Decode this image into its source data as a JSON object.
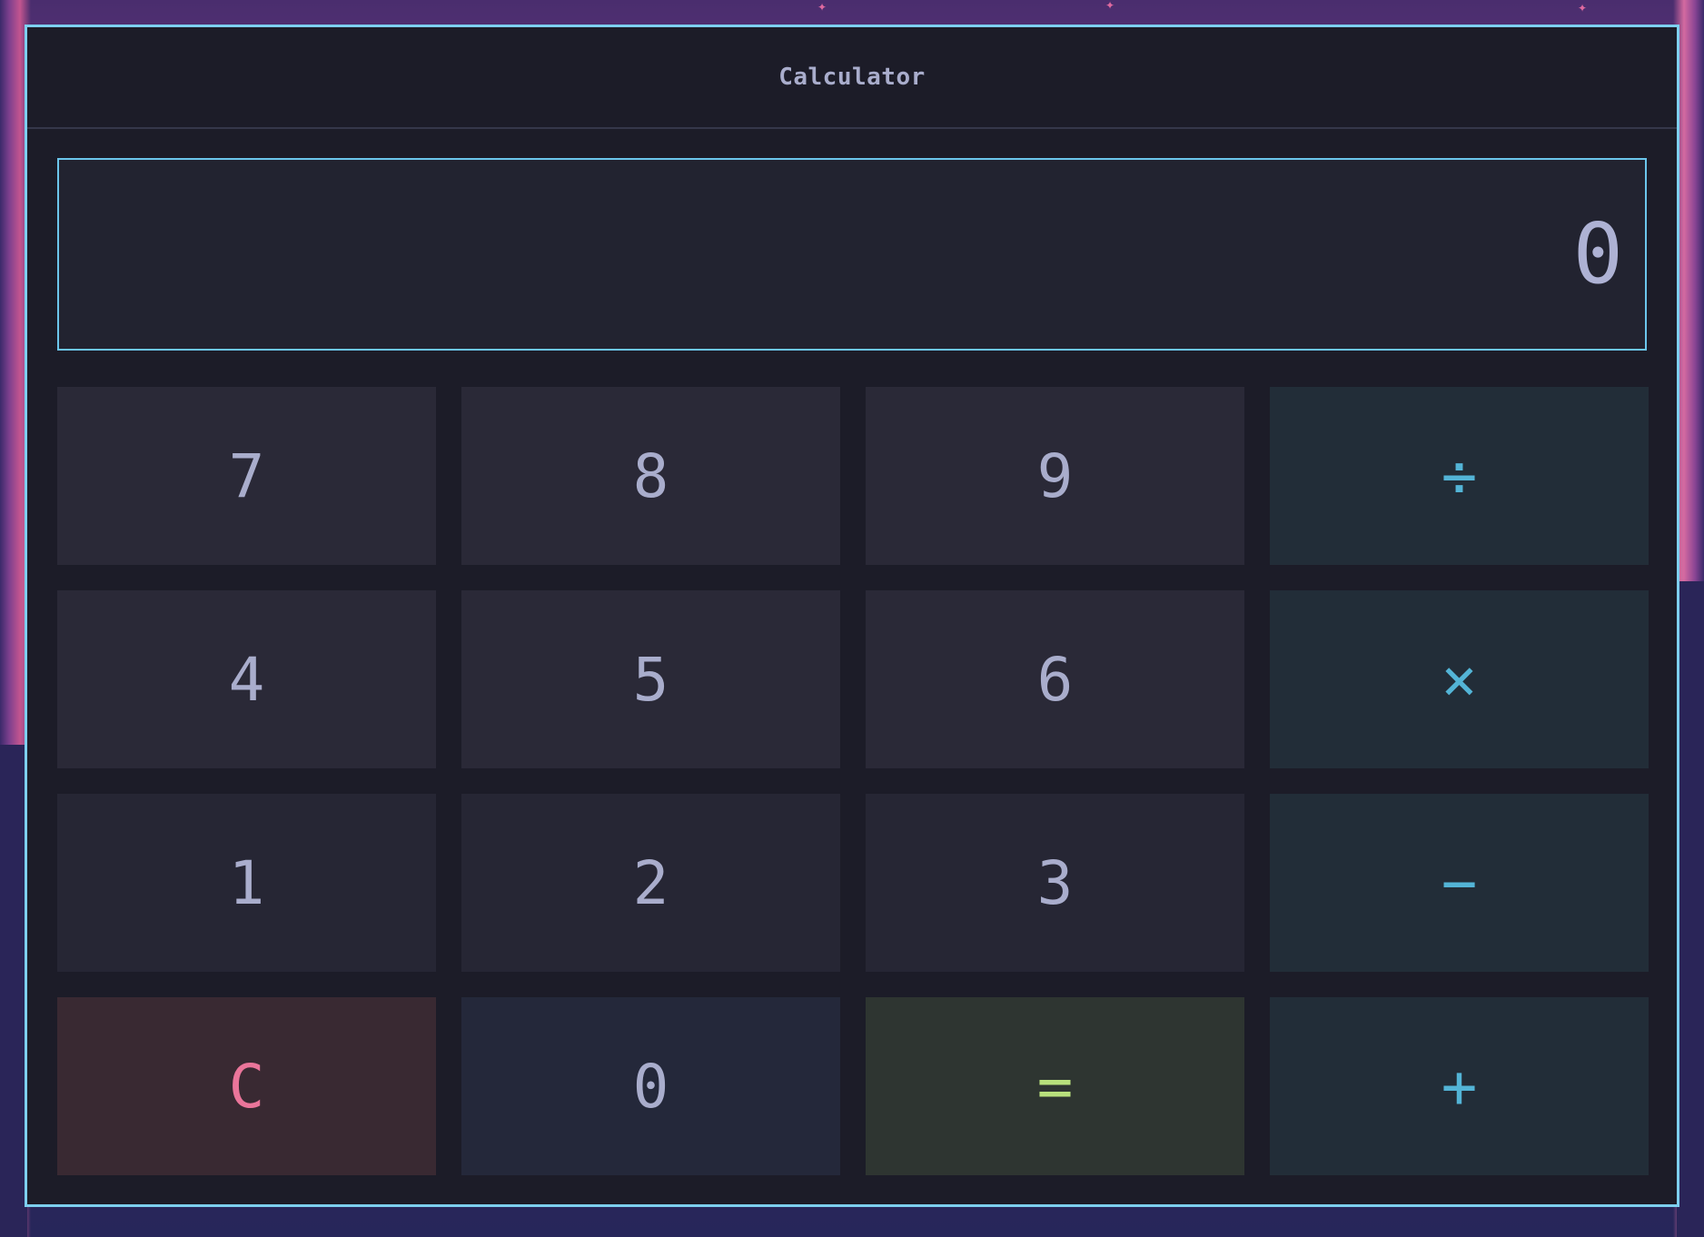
{
  "app": {
    "title": "Calculator"
  },
  "display": {
    "value": "0"
  },
  "keypad": {
    "rows": [
      [
        {
          "label": "7",
          "kind": "digit"
        },
        {
          "label": "8",
          "kind": "digit"
        },
        {
          "label": "9",
          "kind": "digit"
        },
        {
          "label": "÷",
          "kind": "operator"
        }
      ],
      [
        {
          "label": "4",
          "kind": "digit"
        },
        {
          "label": "5",
          "kind": "digit"
        },
        {
          "label": "6",
          "kind": "digit"
        },
        {
          "label": "×",
          "kind": "operator"
        }
      ],
      [
        {
          "label": "1",
          "kind": "digit"
        },
        {
          "label": "2",
          "kind": "digit"
        },
        {
          "label": "3",
          "kind": "digit"
        },
        {
          "label": "−",
          "kind": "operator"
        }
      ],
      [
        {
          "label": "C",
          "kind": "clear"
        },
        {
          "label": "0",
          "kind": "digit"
        },
        {
          "label": "=",
          "kind": "equals"
        },
        {
          "label": "+",
          "kind": "operator"
        }
      ]
    ]
  },
  "colors": {
    "window_border": "#7dcfef",
    "window_bg": "#1c1c28",
    "display_border": "#6cc6ec",
    "text": "#a9adcc",
    "operator": "#53b4d6",
    "clear": "#ea759a",
    "equals": "#b8e07c"
  }
}
